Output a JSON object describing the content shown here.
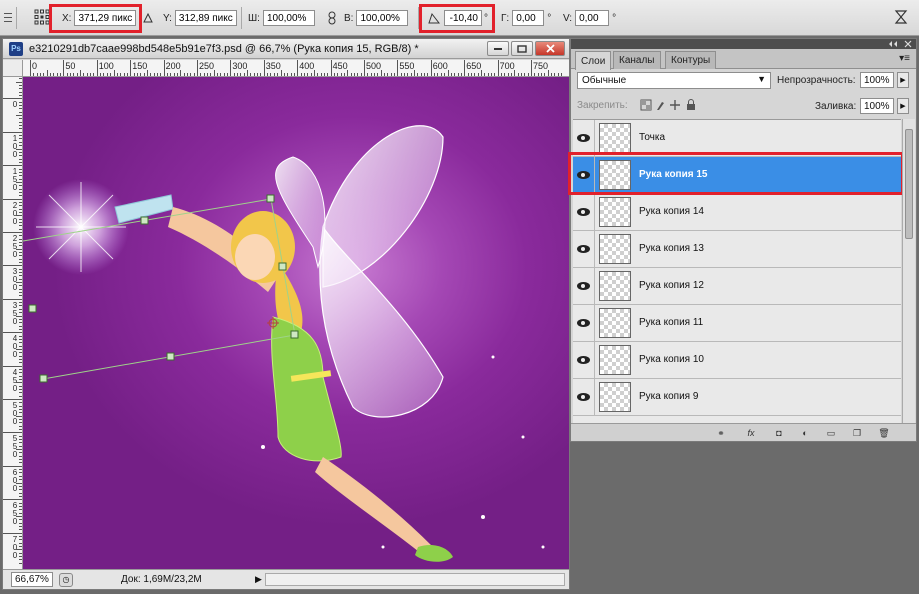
{
  "options_bar": {
    "x_label": "X:",
    "x_value": "371,29 пикс",
    "y_label": "Y:",
    "y_value": "312,89 пикс",
    "w_label": "Ш:",
    "w_value": "100,00%",
    "h_label": "В:",
    "h_value": "100,00%",
    "angle_value": "-10,40",
    "angle_unit": "°",
    "hskew_label": "Г:",
    "hskew_value": "0,00",
    "hskew_unit": "°",
    "vskew_label": "V:",
    "vskew_value": "0,00",
    "vskew_unit": "°"
  },
  "document": {
    "title": "e3210291db7caae998bd548e5b91e7f3.psd @ 66,7% (Рука копия 15, RGB/8) *",
    "app_badge": "Ps",
    "ruler_top_labels": [
      "0",
      "50",
      "100",
      "150",
      "200",
      "250",
      "300",
      "350",
      "400",
      "450",
      "500",
      "550",
      "600",
      "650",
      "700",
      "750"
    ],
    "ruler_left_labels": [
      "5",
      "0",
      "1\n0\n0",
      "1\n5\n0",
      "2\n0\n0",
      "2\n5\n0",
      "3\n0\n0",
      "3\n5\n0",
      "4\n0\n0",
      "4\n5\n0",
      "5\n0\n0",
      "5\n5\n0",
      "6\n0\n0",
      "6\n5\n0",
      "7\n0\n0"
    ],
    "zoom": "66,67%",
    "doc_info": "Док: 1,69M/23,2M"
  },
  "layers_panel": {
    "tabs": [
      "Слои",
      "Каналы",
      "Контуры"
    ],
    "active_tab": 0,
    "blend_mode": "Обычные",
    "opacity_label": "Непрозрачность:",
    "opacity_value": "100%",
    "lock_label": "Закрепить:",
    "fill_label": "Заливка:",
    "fill_value": "100%",
    "layers": [
      {
        "name": "Точка",
        "selected": false
      },
      {
        "name": "Рука копия 15",
        "selected": true
      },
      {
        "name": "Рука копия 14",
        "selected": false
      },
      {
        "name": "Рука копия 13",
        "selected": false
      },
      {
        "name": "Рука копия 12",
        "selected": false
      },
      {
        "name": "Рука копия 11",
        "selected": false
      },
      {
        "name": "Рука копия 10",
        "selected": false
      },
      {
        "name": "Рука копия 9",
        "selected": false
      }
    ]
  },
  "colors": {
    "highlight": "#e2212b",
    "selection": "#3a8ee6",
    "canvas_bg": "#8a2a9c"
  }
}
